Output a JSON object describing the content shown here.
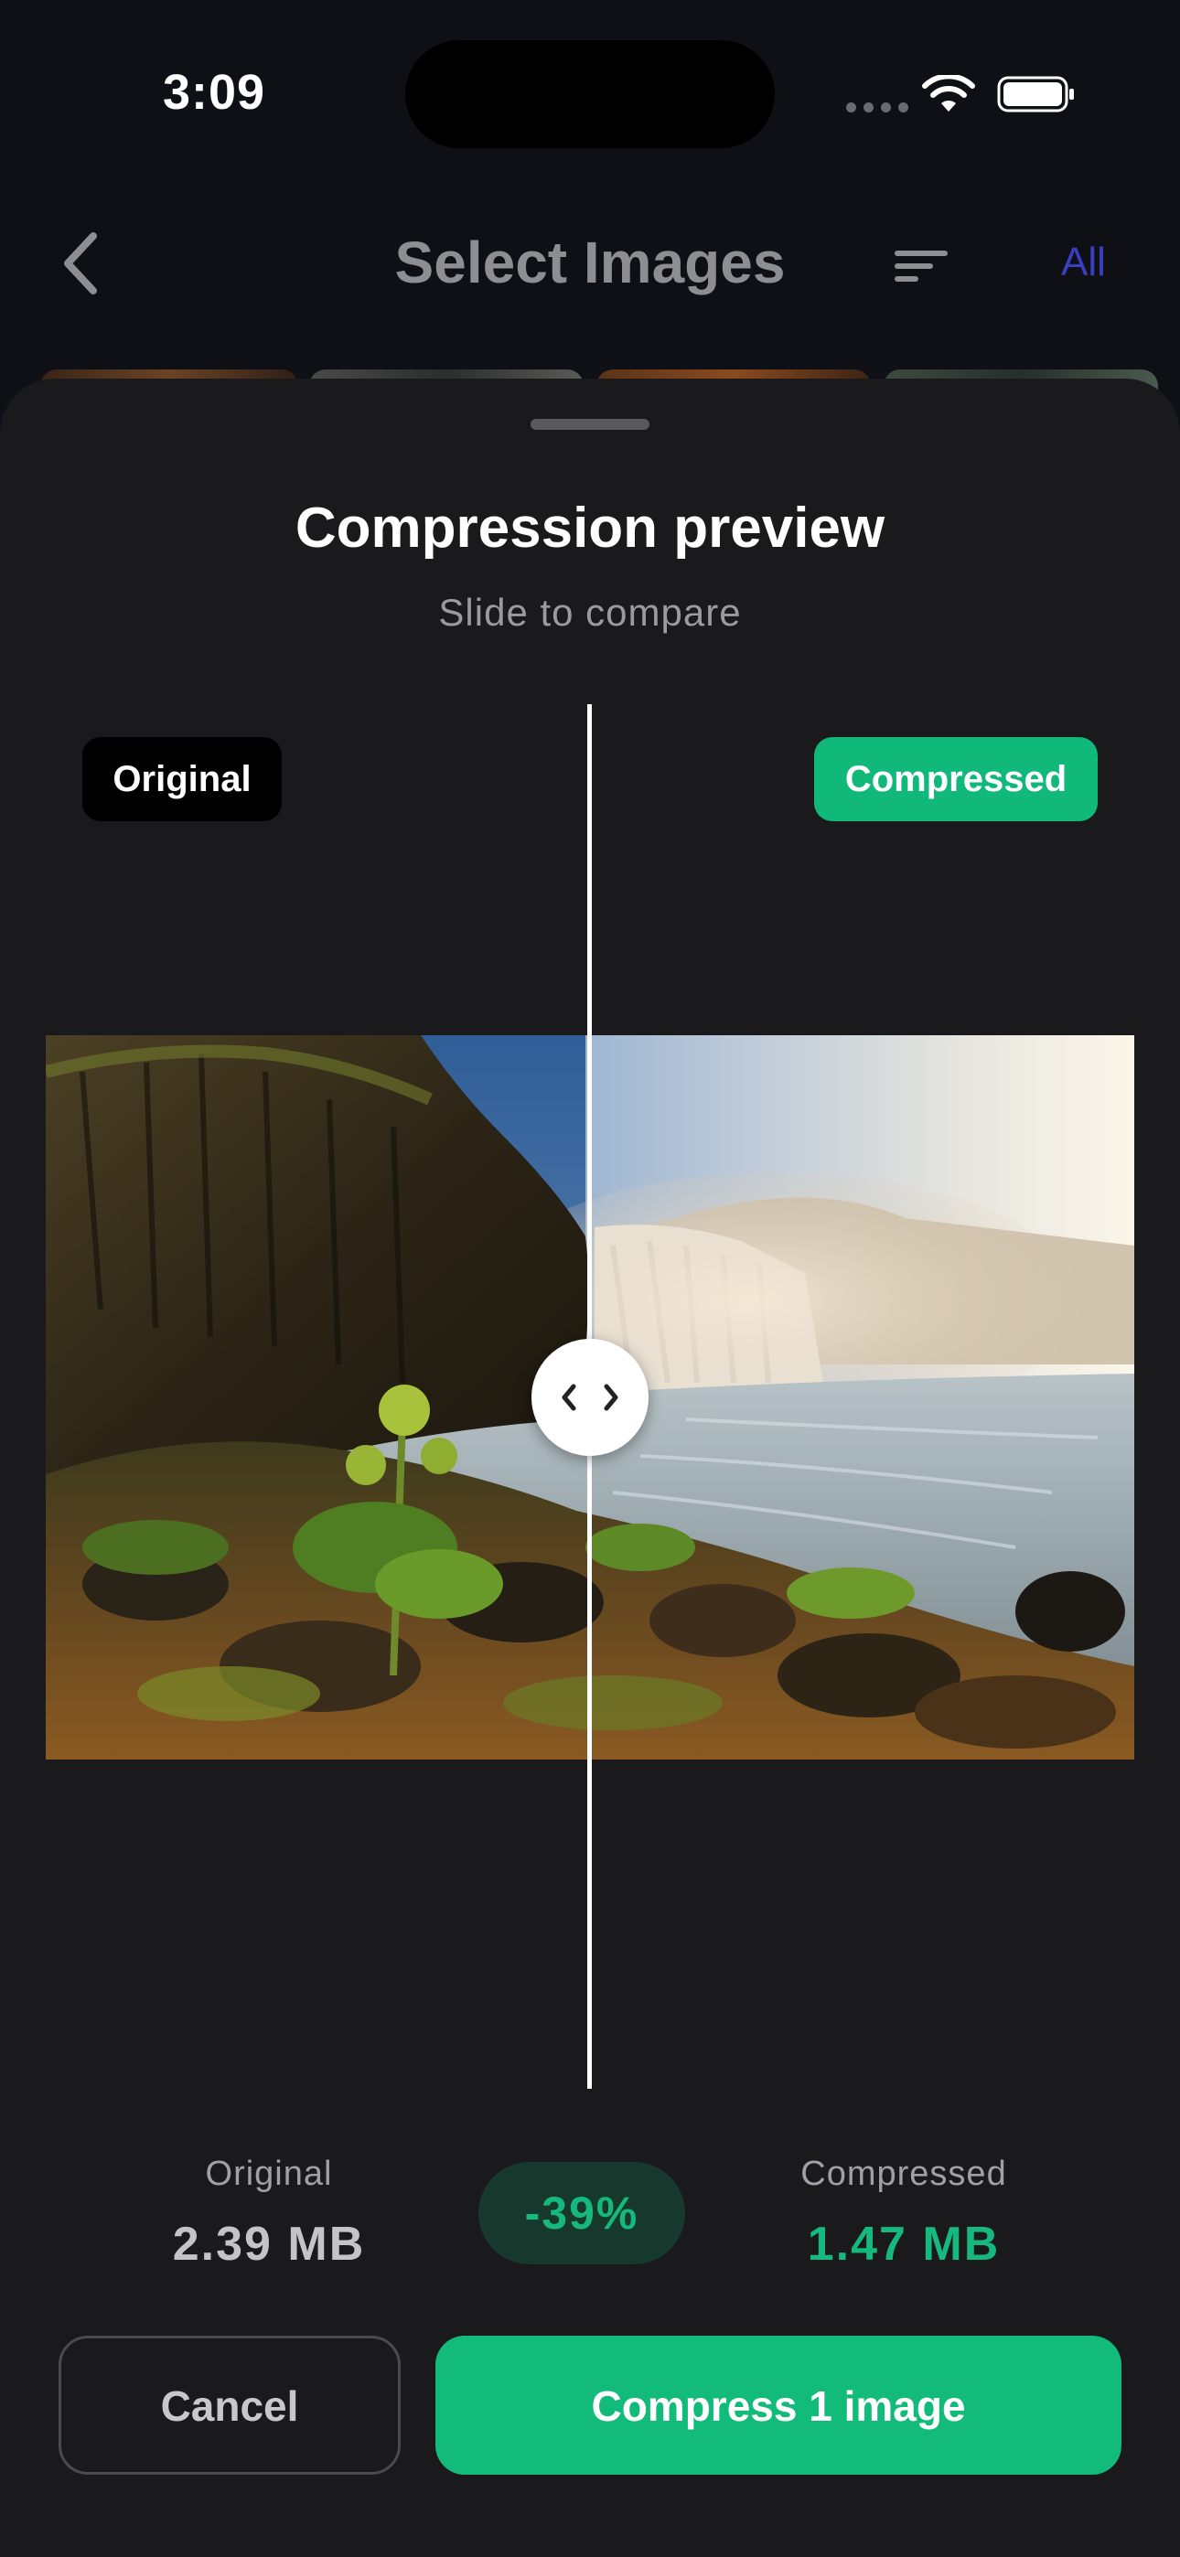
{
  "status_bar": {
    "time": "3:09"
  },
  "nav": {
    "title": "Select Images",
    "all_label": "All"
  },
  "sheet": {
    "title": "Compression preview",
    "subtitle": "Slide to compare",
    "badge_original": "Original",
    "badge_compressed": "Compressed",
    "stats": {
      "original_label": "Original",
      "original_value": "2.39 MB",
      "reduction": "-39%",
      "compressed_label": "Compressed",
      "compressed_value": "1.47 MB"
    },
    "cancel_label": "Cancel",
    "compress_label": "Compress 1 image"
  },
  "colors": {
    "accent": "#13bb7b",
    "nav_all": "#3a3fbf",
    "sheet_bg": "#1a1a1c"
  },
  "icons": {
    "back": "chevron-left-icon",
    "sort": "sort-icon",
    "handle": "compare-arrows-icon",
    "wifi": "wifi-icon",
    "battery": "battery-icon"
  },
  "slider": {
    "position_fraction": 0.5
  }
}
